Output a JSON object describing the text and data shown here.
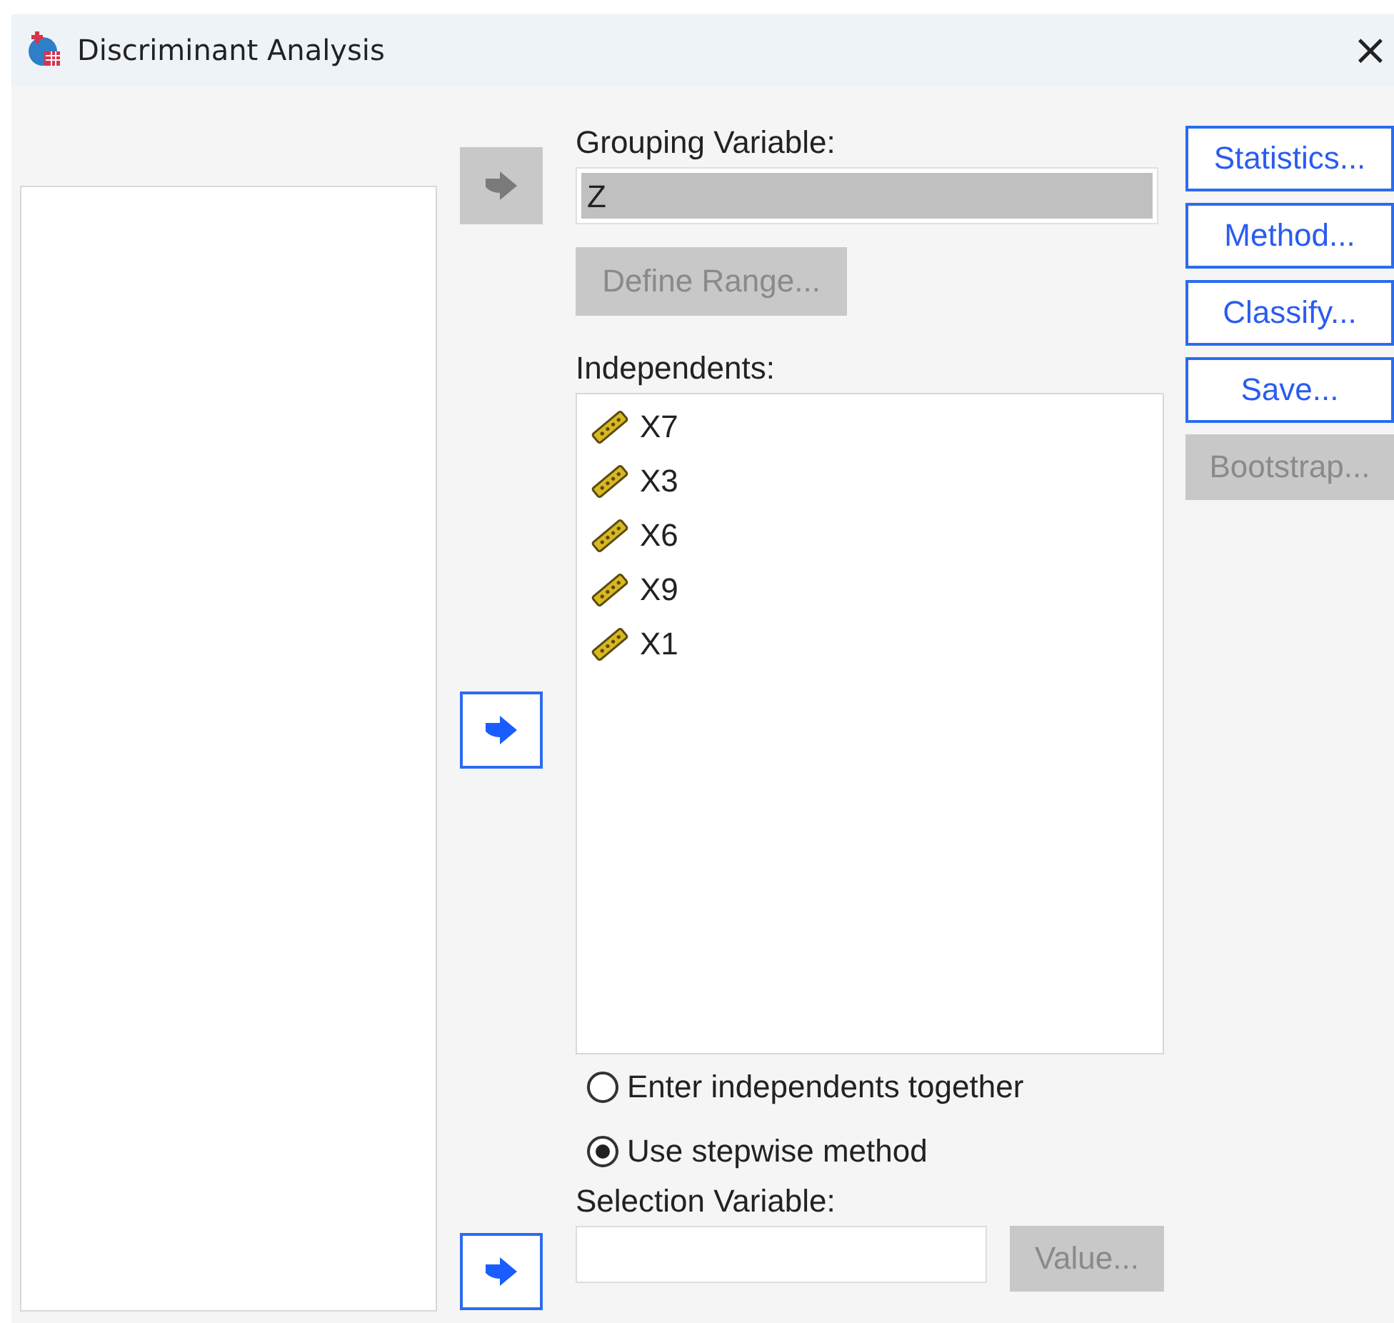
{
  "window": {
    "title": "Discriminant Analysis",
    "close": "×"
  },
  "grouping": {
    "label": "Grouping Variable:",
    "value": "Z",
    "arrow_disabled": true,
    "define_range": {
      "label": "Define Range...",
      "disabled": true
    }
  },
  "independents": {
    "label": "Independents:",
    "arrow_disabled": false,
    "items": [
      {
        "name": "X7"
      },
      {
        "name": "X3"
      },
      {
        "name": "X6"
      },
      {
        "name": "X9"
      },
      {
        "name": "X1"
      }
    ]
  },
  "method": [
    {
      "label": "Enter independents together",
      "selected": false
    },
    {
      "label": "Use stepwise method",
      "selected": true
    }
  ],
  "selection": {
    "label": "Selection Variable:",
    "arrow_disabled": false,
    "value_button": {
      "label": "Value...",
      "disabled": true
    }
  },
  "buttons": [
    {
      "label": "Statistics...",
      "disabled": false
    },
    {
      "label": "Method...",
      "disabled": false
    },
    {
      "label": "Classify...",
      "disabled": false
    },
    {
      "label": "Save...",
      "disabled": false
    },
    {
      "label": "Bootstrap...",
      "disabled": true
    }
  ]
}
